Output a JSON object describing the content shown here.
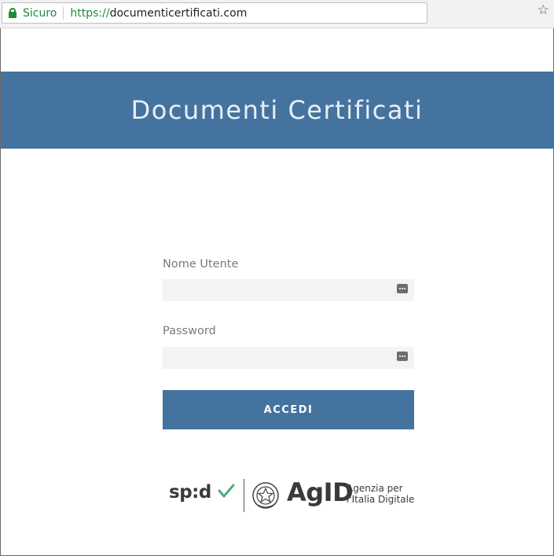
{
  "browser": {
    "security_label": "Sicuro",
    "url_scheme": "https://",
    "url_host": "documenticertificati.com"
  },
  "header": {
    "title": "Documenti Certificati",
    "color": "#44739f"
  },
  "form": {
    "username_label": "Nome Utente",
    "username_value": "",
    "password_label": "Password",
    "password_value": "",
    "submit_label": "ACCEDI"
  },
  "logos": {
    "spid": "sp:d",
    "agid": "AgID",
    "agid_line1": "Agenzia per",
    "agid_line2": "l'Italia Digitale"
  },
  "icons": {
    "lock": "lock-icon",
    "star": "bookmark-star-icon",
    "credentials": "password-manager-icon"
  }
}
